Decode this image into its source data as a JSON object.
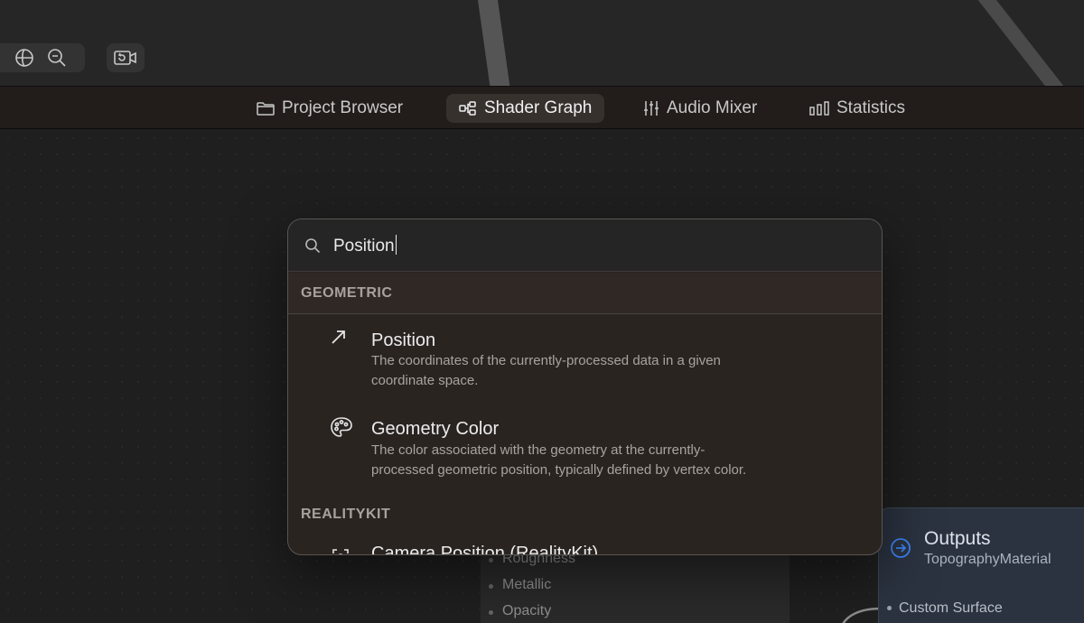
{
  "viewport": {
    "tools": [
      "globe-icon",
      "zoom-icon"
    ],
    "camera_tool": "camera-icon"
  },
  "tabs": [
    {
      "label": "Project Browser",
      "icon": "folder-icon",
      "active": false
    },
    {
      "label": "Shader Graph",
      "icon": "graph-nodes-icon",
      "active": true
    },
    {
      "label": "Audio Mixer",
      "icon": "sliders-icon",
      "active": false
    },
    {
      "label": "Statistics",
      "icon": "bar-chart-icon",
      "active": false
    }
  ],
  "search": {
    "value": "Position",
    "icon": "search-icon"
  },
  "sections": [
    {
      "header": "GEOMETRIC",
      "results": [
        {
          "title": "Position",
          "icon": "arrow-up-right-icon",
          "description_lines": [
            "The coordinates of the currently-processed data in a given",
            "coordinate space."
          ]
        },
        {
          "title": "Geometry Color",
          "icon": "palette-icon",
          "description_lines": [
            "The color associated with the geometry at the currently-",
            "processed geometric position, typically defined by vertex color."
          ]
        }
      ]
    },
    {
      "header": "REALITYKIT",
      "results": [
        {
          "title": "Camera Position (RealityKit)",
          "icon": "camera-frame-icon"
        }
      ]
    }
  ],
  "background_node": {
    "properties": [
      "Roughness",
      "Metallic",
      "Opacity"
    ]
  },
  "outputs_node": {
    "title": "Outputs",
    "subtitle": "TopographyMaterial",
    "port": "Custom Surface",
    "accent": "#3c82f6"
  }
}
